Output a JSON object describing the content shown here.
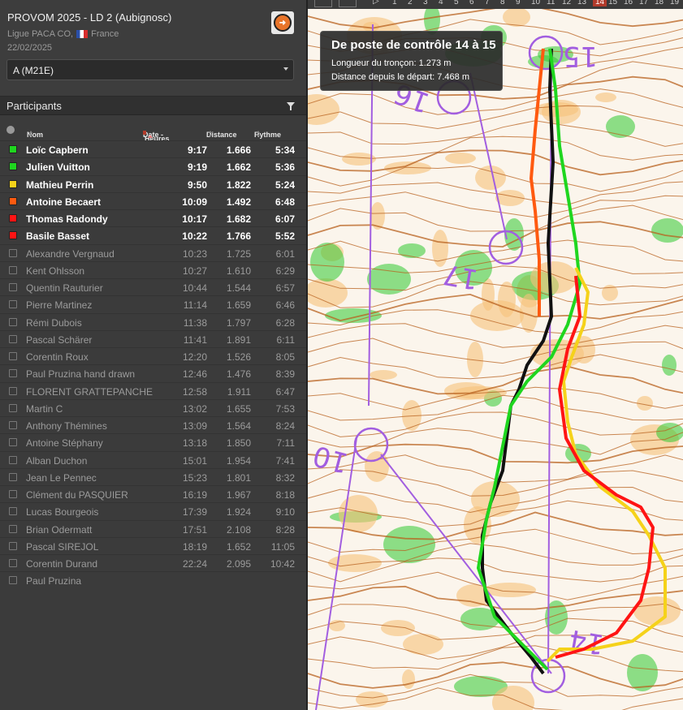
{
  "event": {
    "title": "PROVOM 2025 - LD 2 (Aubignosc)",
    "organizer": "Ligue PACA CO,",
    "country": "France",
    "date": "22/02/2025"
  },
  "course_select": {
    "value": "A (M21E)"
  },
  "participants_header": {
    "label": "Participants"
  },
  "columns": {
    "name": "Nom",
    "date": "Date - ",
    "hours": "Heures",
    "distance": "Distance",
    "pace": "Rythme"
  },
  "participants": [
    {
      "name": "Loïc Capbern",
      "time": "9:17",
      "distance": "1.666",
      "pace": "5:34",
      "selected": true,
      "color": "#1fd61f"
    },
    {
      "name": "Julien Vuitton",
      "time": "9:19",
      "distance": "1.662",
      "pace": "5:36",
      "selected": true,
      "color": "#1fd61f"
    },
    {
      "name": "Mathieu Perrin",
      "time": "9:50",
      "distance": "1.822",
      "pace": "5:24",
      "selected": true,
      "color": "#f5d21a"
    },
    {
      "name": "Antoine Becaert",
      "time": "10:09",
      "distance": "1.492",
      "pace": "6:48",
      "selected": true,
      "color": "#ff5a10"
    },
    {
      "name": "Thomas Radondy",
      "time": "10:17",
      "distance": "1.682",
      "pace": "6:07",
      "selected": true,
      "color": "#ff1414"
    },
    {
      "name": "Basile Basset",
      "time": "10:22",
      "distance": "1.766",
      "pace": "5:52",
      "selected": true,
      "color": "#ff1414"
    },
    {
      "name": "Alexandre Vergnaud",
      "time": "10:23",
      "distance": "1.725",
      "pace": "6:01",
      "selected": false
    },
    {
      "name": "Kent Ohlsson",
      "time": "10:27",
      "distance": "1.610",
      "pace": "6:29",
      "selected": false
    },
    {
      "name": "Quentin Rauturier",
      "time": "10:44",
      "distance": "1.544",
      "pace": "6:57",
      "selected": false
    },
    {
      "name": "Pierre Martinez",
      "time": "11:14",
      "distance": "1.659",
      "pace": "6:46",
      "selected": false
    },
    {
      "name": "Rémi Dubois",
      "time": "11:38",
      "distance": "1.797",
      "pace": "6:28",
      "selected": false
    },
    {
      "name": "Pascal Schärer",
      "time": "11:41",
      "distance": "1.891",
      "pace": "6:11",
      "selected": false
    },
    {
      "name": "Corentin Roux",
      "time": "12:20",
      "distance": "1.526",
      "pace": "8:05",
      "selected": false
    },
    {
      "name": "Paul Pruzina hand drawn",
      "time": "12:46",
      "distance": "1.476",
      "pace": "8:39",
      "selected": false
    },
    {
      "name": "FLORENT GRATTEPANCHE",
      "time": "12:58",
      "distance": "1.911",
      "pace": "6:47",
      "selected": false
    },
    {
      "name": "Martin C",
      "time": "13:02",
      "distance": "1.655",
      "pace": "7:53",
      "selected": false
    },
    {
      "name": "Anthony Thémines",
      "time": "13:09",
      "distance": "1.564",
      "pace": "8:24",
      "selected": false
    },
    {
      "name": "Antoine Stéphany",
      "time": "13:18",
      "distance": "1.850",
      "pace": "7:11",
      "selected": false
    },
    {
      "name": "Alban Duchon",
      "time": "15:01",
      "distance": "1.954",
      "pace": "7:41",
      "selected": false
    },
    {
      "name": "Jean Le Pennec",
      "time": "15:23",
      "distance": "1.801",
      "pace": "8:32",
      "selected": false
    },
    {
      "name": "Clément du PASQUIER",
      "time": "16:19",
      "distance": "1.967",
      "pace": "8:18",
      "selected": false
    },
    {
      "name": "Lucas Bourgeois",
      "time": "17:39",
      "distance": "1.924",
      "pace": "9:10",
      "selected": false
    },
    {
      "name": "Brian Odermatt",
      "time": "17:51",
      "distance": "2.108",
      "pace": "8:28",
      "selected": false
    },
    {
      "name": "Pascal SIREJOL",
      "time": "18:19",
      "distance": "1.652",
      "pace": "11:05",
      "selected": false
    },
    {
      "name": "Corentin Durand",
      "time": "22:24",
      "distance": "2.095",
      "pace": "10:42",
      "selected": false
    },
    {
      "name": "Paul Pruzina",
      "time": "",
      "distance": "",
      "pace": "",
      "selected": false
    }
  ],
  "leg_nav": {
    "numbers": [
      "1",
      "2",
      "3",
      "4",
      "5",
      "6",
      "7",
      "8",
      "9",
      "10",
      "11",
      "12",
      "13",
      "14",
      "15",
      "16",
      "17",
      "18",
      "19"
    ],
    "active": "14"
  },
  "tooltip": {
    "title": "De poste de contrôle 14 à 15",
    "segment_length": "Longueur du tronçon: 1.273 m",
    "distance_from_start": "Distance depuis le départ: 7.468 m"
  },
  "map": {
    "control_numbers": [
      "15",
      "16",
      "17",
      "10",
      "14"
    ],
    "colors": {
      "course": "#a25ee0",
      "contour": "#b8601e",
      "vegetation": "#32c832",
      "open": "#f6c27a"
    }
  }
}
